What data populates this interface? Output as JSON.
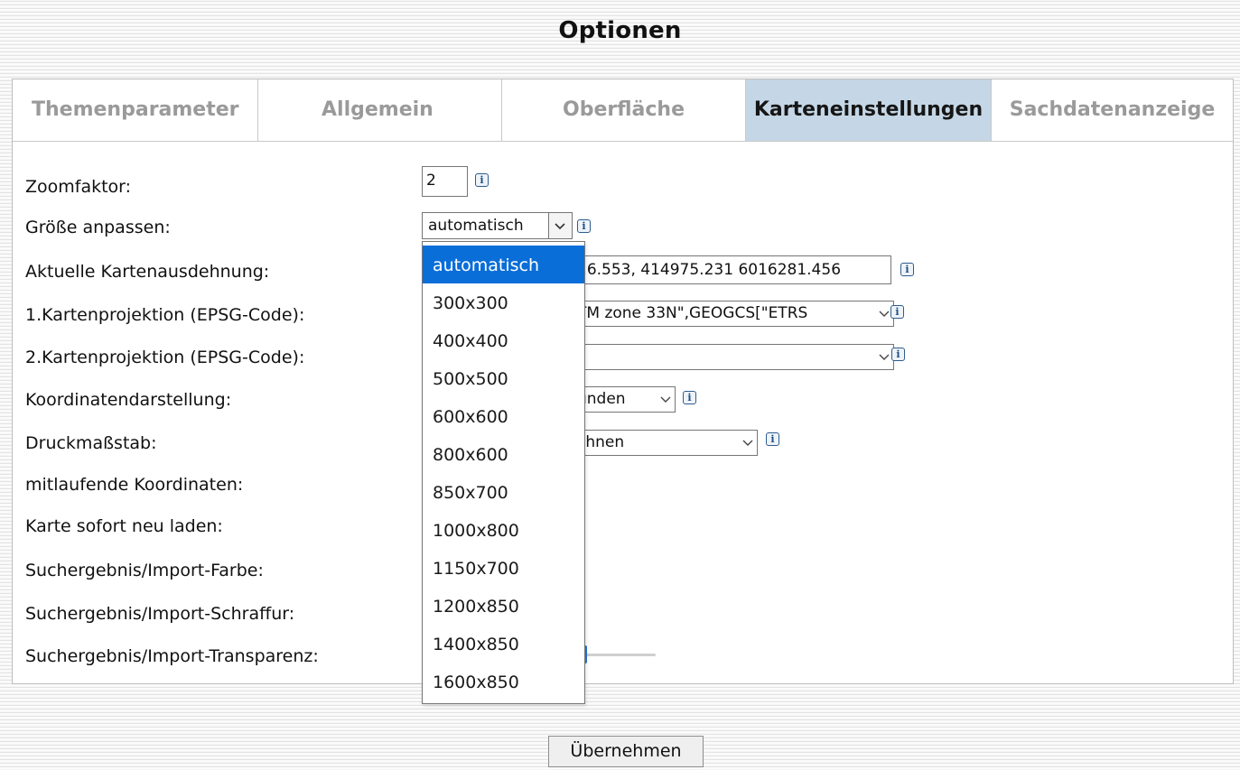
{
  "page": {
    "title": "Optionen"
  },
  "tabs": [
    {
      "label": "Themenparameter",
      "active": false
    },
    {
      "label": "Allgemein",
      "active": false
    },
    {
      "label": "Oberfläche",
      "active": false
    },
    {
      "label": "Karteneinstellungen",
      "active": true
    },
    {
      "label": "Sachdatenanzeige",
      "active": false
    }
  ],
  "form": {
    "zoom": {
      "label": "Zoomfaktor:",
      "value": "2"
    },
    "size": {
      "label": "Größe anpassen:",
      "value": "automatisch"
    },
    "extent": {
      "label": "Aktuelle Kartenausdehnung:",
      "value": "26.553, 414975.231 6016281.456"
    },
    "proj1": {
      "label": "1.Kartenprojektion (EPSG-Code):",
      "value": "TM zone 33N\",GEOGCS[\"ETRS"
    },
    "proj2": {
      "label": "2.Kartenprojektion (EPSG-Code):",
      "value": ""
    },
    "coord_display": {
      "label": "Koordinatendarstellung:",
      "value": "unden"
    },
    "print_scale": {
      "label": "Druckmaßstab:",
      "value": "chnen"
    },
    "live_coords": {
      "label": "mitlaufende Koordinaten:"
    },
    "reload": {
      "label": "Karte sofort neu laden:"
    },
    "search_color": {
      "label": "Suchergebnis/Import-Farbe:"
    },
    "search_hatch": {
      "label": "Suchergebnis/Import-Schraffur:"
    },
    "search_transparency": {
      "label": "Suchergebnis/Import-Transparenz:",
      "level_percent": 5
    }
  },
  "dropdown": {
    "options": [
      "automatisch",
      "300x300",
      "400x400",
      "500x500",
      "600x600",
      "800x600",
      "850x700",
      "1000x800",
      "1150x700",
      "1200x850",
      "1400x850",
      "1600x850"
    ],
    "selected_index": 0
  },
  "footer": {
    "apply_label": "Übernehmen"
  },
  "icons": {
    "info": "info-icon",
    "chevron": "chevron-down-icon"
  },
  "colors": {
    "active_tab": "#c5d7e6",
    "selection": "#0a6ed8",
    "info_icon": "#2d5d8e"
  }
}
